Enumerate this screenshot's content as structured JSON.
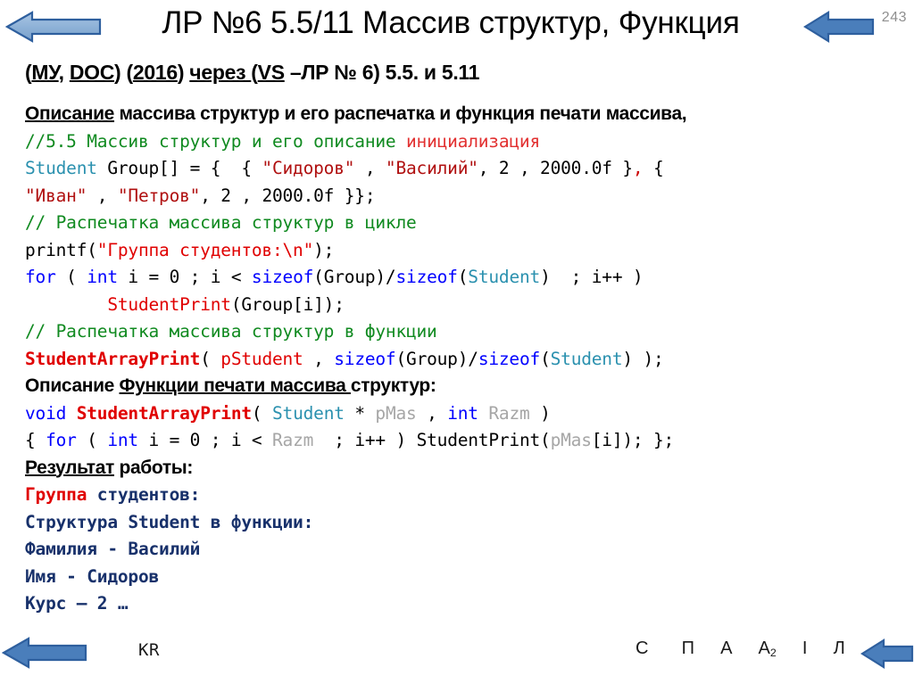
{
  "slide": {
    "page_number": "243",
    "title": "ЛР №6 5.5/11 Массив структур, Функция",
    "subtitle_parts": {
      "p1": "(",
      "p2": "МУ",
      "p3": ", ",
      "p4": "DOC",
      "p5": ") (",
      "p6": "2016",
      "p7": ") ",
      "p8": "через ",
      "p9": "(",
      "p10": "VS",
      "p11": " –ЛР № 6) 5.5. и 5.11"
    },
    "subtitle_plain": "(МУ, DOC) (2016) через (VS –ЛР № 6) 5.5. и 5.11"
  },
  "headings": {
    "description_line": {
      "underlined": "Описание",
      "rest": " массива структур и его распечатка и функция печати массива,"
    },
    "function_description_line": {
      "prefix": "Описание ",
      "underlined": "Функции печати массива ",
      "rest": "структур:"
    },
    "result_line": {
      "underlined": "Результат",
      "rest": " работы:"
    }
  },
  "code": {
    "line1": {
      "comment_green": "//5.5 Массив структур и его описание ",
      "comment_red": "инициализация"
    },
    "line2": {
      "type": "Student",
      "rest1": " Group[] = {  { ",
      "str1": "\"Сидоров\"",
      "rest2": " , ",
      "str2": "\"Василий\"",
      "rest3": ", 2 , 2000.0f }",
      "comma_red": ",",
      "rest4": " {"
    },
    "line3": {
      "str1": "\"Иван\"",
      "rest1": " , ",
      "str2": "\"Петров\"",
      "rest2": ", 2 , 2000.0f }};"
    },
    "line4": {
      "comment": "// Распечатка массива структур в цикле"
    },
    "line5": {
      "pre": "printf(",
      "str": "\"Группа студентов:\\n\"",
      "post": ");"
    },
    "line6": {
      "kw1": "for",
      "t1": " ( ",
      "kw2": "int",
      "t2": " i = 0 ; i < ",
      "kw3": "sizeof",
      "t3": "(Group)/",
      "kw4": "sizeof",
      "t4": "(",
      "type1": "Student",
      "t5": ")  ; i++ )"
    },
    "line7": {
      "indent": "        ",
      "fn": "StudentPrint",
      "rest": "(Group[i]);"
    },
    "line8": {
      "comment": "// Распечатка массива структур в функции"
    },
    "line9": {
      "fn": "StudentArrayPrint",
      "t1": "( ",
      "arg": "pStudent",
      "t2": " , ",
      "kw1": "sizeof",
      "t3": "(Group)/",
      "kw2": "sizeof",
      "t4": "(",
      "type1": "Student",
      "t5": ") );"
    },
    "line10": {
      "kw": "void",
      "sp1": " ",
      "fn": "StudentArrayPrint",
      "t1": "( ",
      "type1": "Student",
      "t2": " * ",
      "gray1": "pMas",
      "t3": " , ",
      "kw2": "int",
      "t4": " ",
      "gray2": "Razm",
      "t5": " )"
    },
    "line11": {
      "t1": "{ ",
      "kw1": "for",
      "t2": " ( ",
      "kw2": "int",
      "t3": " i = 0 ; i < ",
      "gray1": "Razm",
      "t4": "  ; i++ ) StudentPrint(",
      "gray2": "pMas",
      "t5": "[i]); };"
    }
  },
  "result": {
    "line1_red": "Группа",
    "line1_rest": " студентов:",
    "line2": "Структура Student в функции:",
    "line3": "Фамилия - Василий",
    "line4": "Имя - Сидоров",
    "line5": "Курс – 2 …"
  },
  "footer": {
    "left_label": "KR",
    "letters": [
      "С",
      "П",
      "А",
      "А",
      "І",
      "Л"
    ],
    "subscript": "2"
  },
  "colors": {
    "keyword": "#0000ff",
    "type": "#2b91af",
    "string": "#b01010",
    "comment": "#108a20",
    "comment_highlight": "#e23030",
    "function": "#e00000",
    "gray_ident": "#a6a6a6",
    "result_navy": "#18316b",
    "arrow_header_fill": "#8fb3d9",
    "arrow_header_stroke": "#2e5f9e",
    "arrow_footer_fill": "#4a7ebb",
    "arrow_footer_stroke": "#2e5f9e",
    "page_number": "#8f8f8f"
  }
}
